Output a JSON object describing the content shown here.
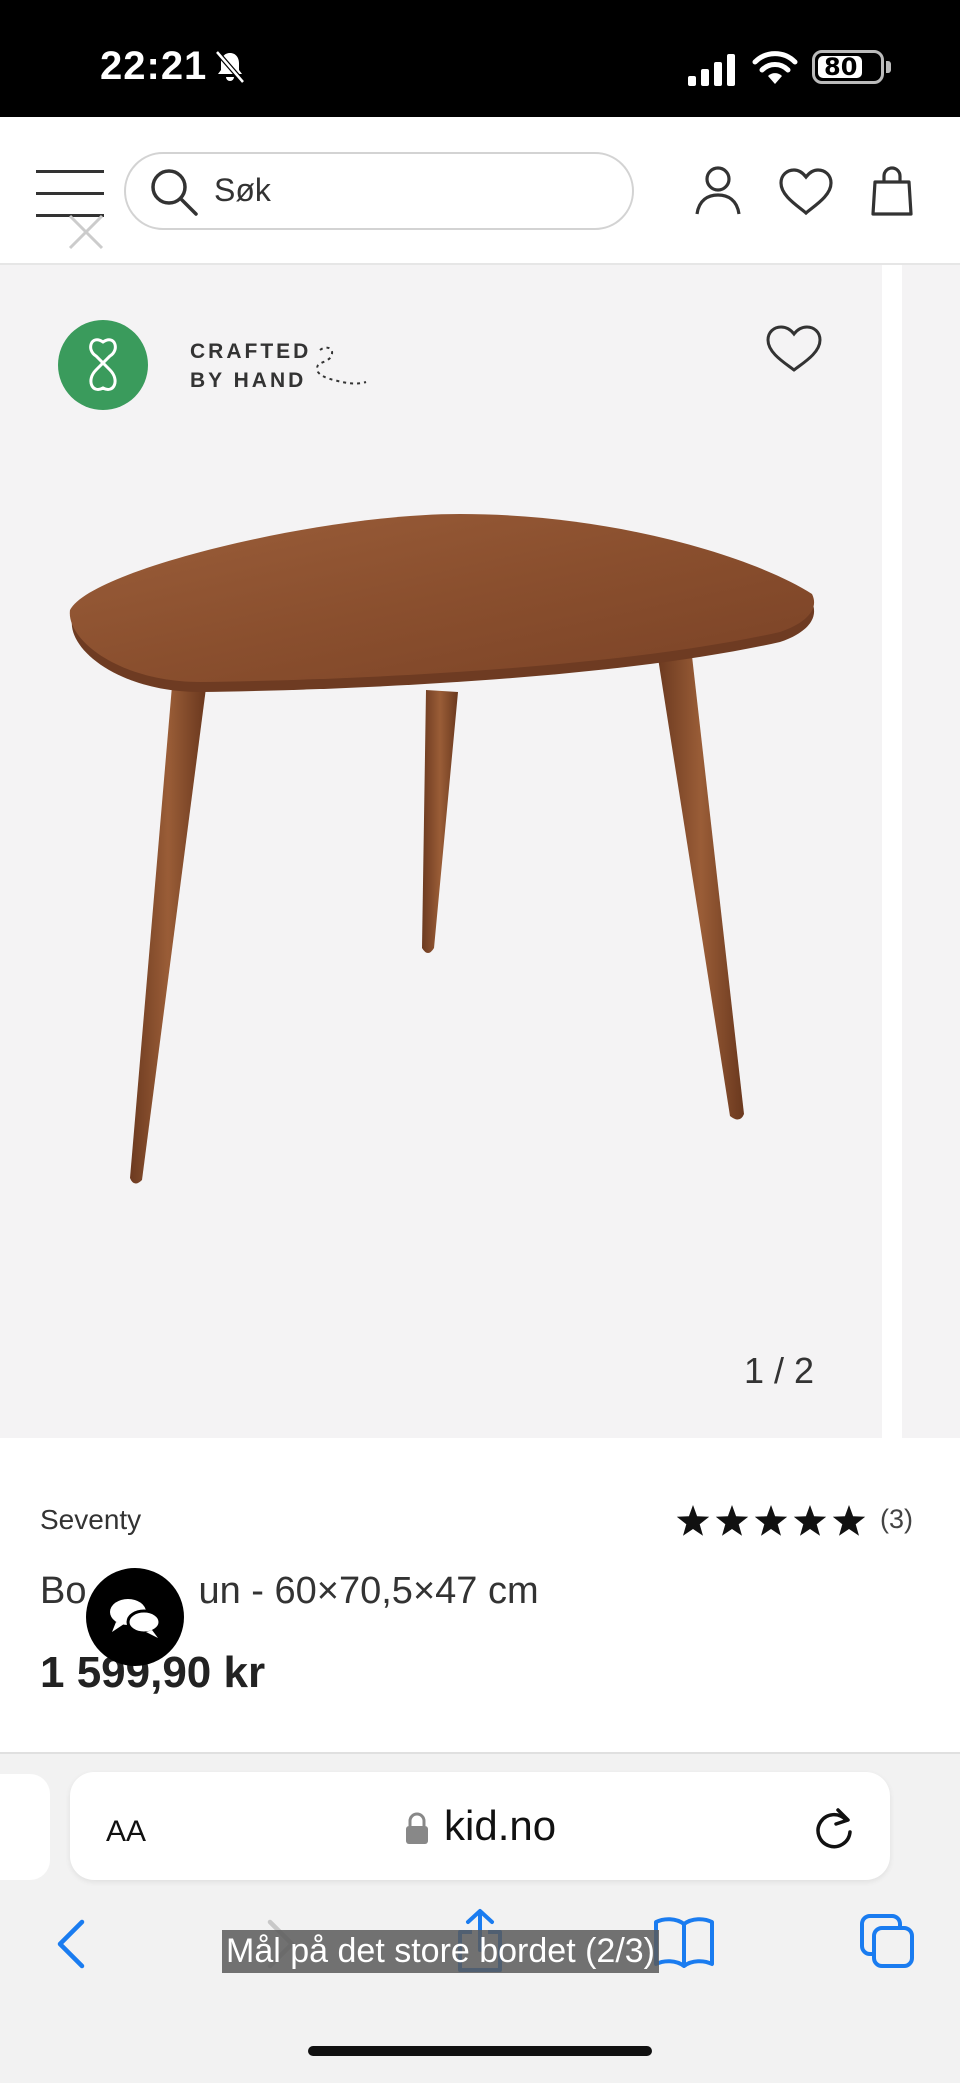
{
  "status_bar": {
    "time": "22:21",
    "battery": "80"
  },
  "header": {
    "search_placeholder": "Søk"
  },
  "gallery": {
    "badge_line1": "CRAFTED",
    "badge_line2": "BY HAND",
    "counter": "1 / 2"
  },
  "product": {
    "brand": "Seventy",
    "rating": 5,
    "review_count": "(3)",
    "name_visible_start": "Bo",
    "name_visible_end": "un - 60×70,5×47 cm",
    "price": "1 599,90 kr"
  },
  "safari": {
    "text_size_label": "AA",
    "url": "kid.no"
  },
  "caption": "Mål på det store bordet (2/3)",
  "colors": {
    "badge_green": "#3a9b5c",
    "gallery_bg": "#f4f3f4",
    "wood": "#8a4f2e",
    "ios_blue": "#1a7cf0"
  },
  "icons": [
    "hamburger-menu-icon",
    "close-icon",
    "search-icon",
    "user-icon",
    "heart-icon",
    "bag-icon",
    "chat-icon",
    "lock-icon",
    "reload-icon",
    "back-icon",
    "forward-icon",
    "share-icon",
    "bookmarks-icon",
    "tabs-icon"
  ]
}
